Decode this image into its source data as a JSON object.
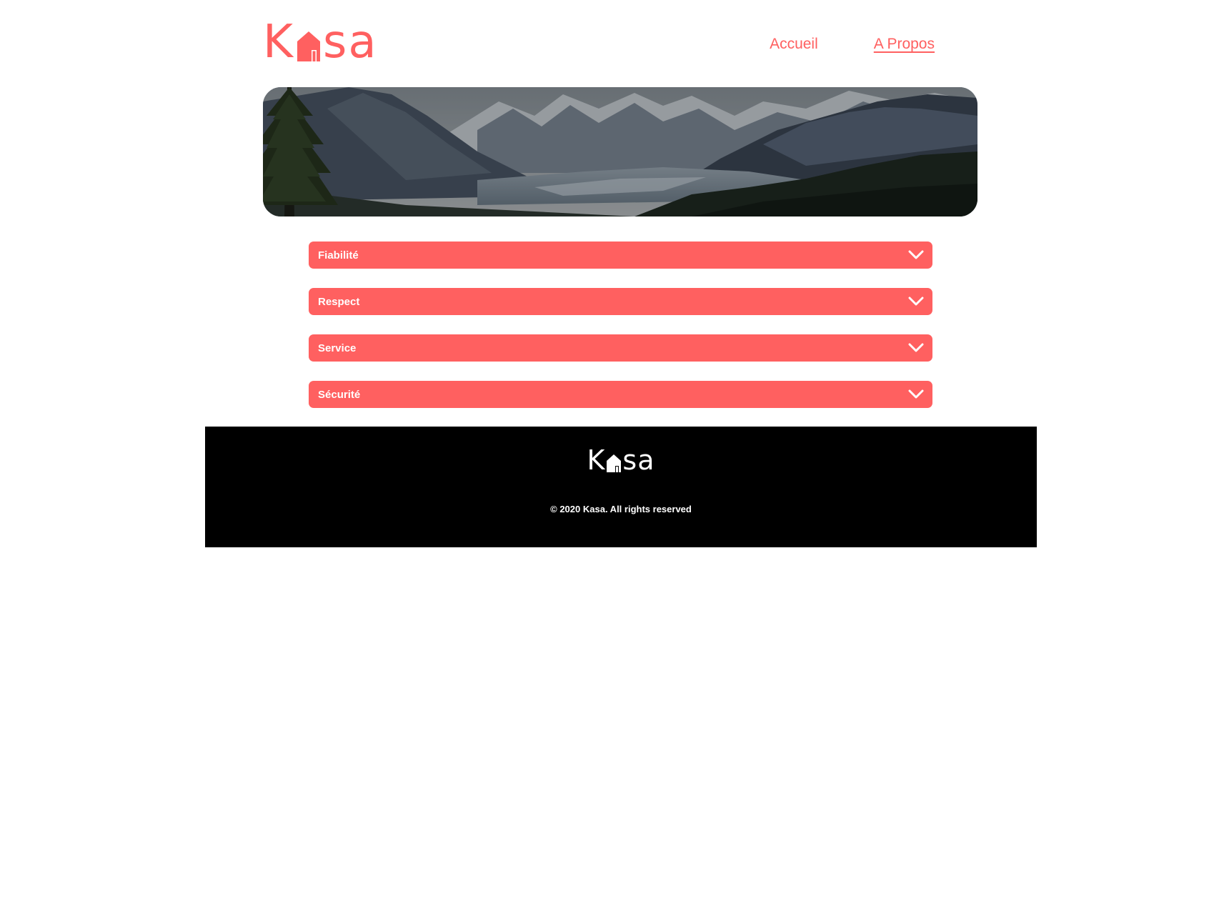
{
  "brand": {
    "name": "Kasa",
    "logo_left": "K",
    "logo_right": "sa",
    "color": "#FF6060"
  },
  "nav": {
    "items": [
      {
        "label": "Accueil",
        "active": false
      },
      {
        "label": "A Propos",
        "active": true
      }
    ]
  },
  "banner": {
    "image": "mountain-valley-landscape"
  },
  "accordion": {
    "items": [
      {
        "label": "Fiabilité",
        "icon": "chevron-down-icon"
      },
      {
        "label": "Respect",
        "icon": "chevron-down-icon"
      },
      {
        "label": "Service",
        "icon": "chevron-down-icon"
      },
      {
        "label": "Sécurité",
        "icon": "chevron-down-icon"
      }
    ]
  },
  "footer": {
    "logo_left": "K",
    "logo_right": "sa",
    "copyright": "© 2020 Kasa. All rights reserved"
  }
}
